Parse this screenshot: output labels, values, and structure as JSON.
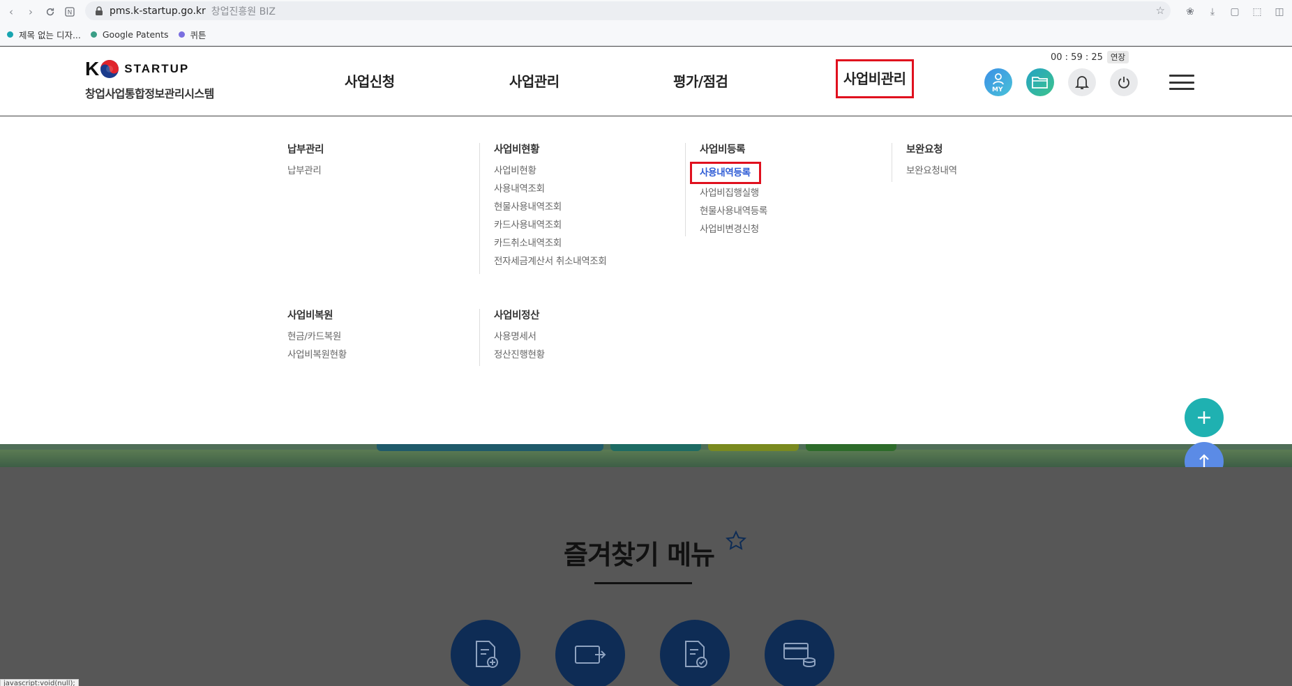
{
  "browser": {
    "url_domain": "pms.k-startup.go.kr",
    "site_name": "창업진흥원 BIZ",
    "status_url": "javascript:void(null);"
  },
  "bookmarks": [
    {
      "label": "제목 없는 디자...",
      "color": "#18a5b0"
    },
    {
      "label": "Google Patents",
      "color": "#3a9e86"
    },
    {
      "label": "퀴튼",
      "color": "#7a6fe0"
    }
  ],
  "header": {
    "logo_mark": "K",
    "logo_text": "STARTUP",
    "logo_subtitle": "창업사업통합정보관리시스템",
    "gnb": [
      "사업신청",
      "사업관리",
      "평가/점검",
      "사업비관리"
    ],
    "active_gnb": "사업비관리",
    "session_time": "00 : 59 : 25",
    "extend_label": "연장",
    "my_label": "MY"
  },
  "mega_menu": {
    "row1": [
      {
        "title": "납부관리",
        "links": [
          "납부관리"
        ]
      },
      {
        "title": "사업비현황",
        "links": [
          "사업비현황",
          "사용내역조회",
          "현물사용내역조회",
          "카드사용내역조회",
          "카드취소내역조회",
          "전자세금계산서 취소내역조회"
        ]
      },
      {
        "title": "사업비등록",
        "links": [
          "사용내역등록",
          "사업비집행실행",
          "현물사용내역등록",
          "사업비변경신청"
        ]
      },
      {
        "title": "보완요청",
        "links": [
          "보완요청내역"
        ]
      }
    ],
    "row2": [
      {
        "title": "사업비복원",
        "links": [
          "현금/카드복원",
          "사업비복원현황"
        ]
      },
      {
        "title": "사업비정산",
        "links": [
          "사용명세서",
          "정산진행현황"
        ]
      }
    ],
    "current_link": "사용내역등록"
  },
  "favorites": {
    "title": "즐겨찾기 메뉴",
    "icons": [
      "document-add-icon",
      "wallet-icon",
      "document-check-icon",
      "card-coins-icon"
    ]
  },
  "colors": {
    "highlight_border": "#e0101e",
    "current_link": "#2f5dd6",
    "float_plus": "#1fb1b1",
    "float_top": "#5b8be6",
    "fav_circle": "#0e2c55"
  }
}
